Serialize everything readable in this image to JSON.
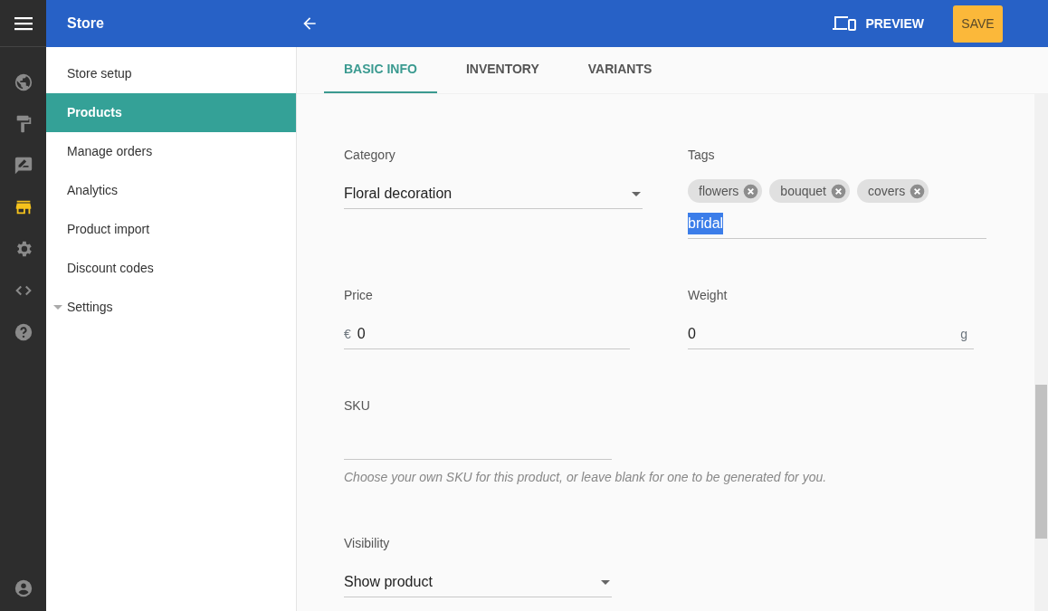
{
  "app_title": "Store",
  "rail": [
    {
      "selected": false
    },
    {
      "selected": false
    },
    {
      "selected": false
    },
    {
      "selected": true
    },
    {
      "selected": false
    },
    {
      "selected": false
    },
    {
      "selected": false
    }
  ],
  "sidebar": {
    "items": [
      {
        "label": "Store setup",
        "selected": false,
        "kind": "link"
      },
      {
        "label": "Products",
        "selected": true,
        "kind": "link"
      },
      {
        "label": "Manage orders",
        "selected": false,
        "kind": "link"
      },
      {
        "label": "Analytics",
        "selected": false,
        "kind": "link"
      },
      {
        "label": "Product import",
        "selected": false,
        "kind": "link"
      },
      {
        "label": "Discount codes",
        "selected": false,
        "kind": "link"
      },
      {
        "label": "Settings",
        "selected": false,
        "kind": "group"
      }
    ]
  },
  "toolbar": {
    "preview": "PREVIEW",
    "save": "SAVE"
  },
  "tabs": [
    {
      "label": "BASIC INFO",
      "selected": true
    },
    {
      "label": "INVENTORY",
      "selected": false
    },
    {
      "label": "VARIANTS",
      "selected": false
    }
  ],
  "form": {
    "category": {
      "label": "Category",
      "value": "Floral decoration"
    },
    "tags": {
      "label": "Tags",
      "chips": [
        "flowers",
        "bouquet",
        "covers"
      ],
      "value": "bridal",
      "text_selected": true
    },
    "price": {
      "label": "Price",
      "prefix": "€",
      "value": "0"
    },
    "weight": {
      "label": "Weight",
      "value": "0",
      "suffix": "g"
    },
    "sku": {
      "label": "SKU",
      "helper": "Choose your own SKU for this product, or leave blank for one to be generated for you."
    },
    "visibility": {
      "label": "Visibility",
      "value": "Show product"
    }
  }
}
